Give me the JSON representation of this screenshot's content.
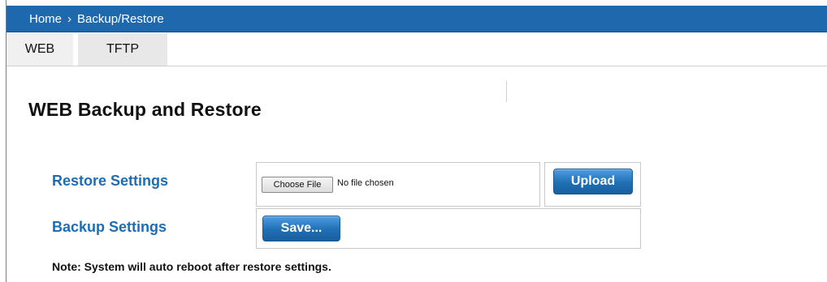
{
  "breadcrumb": {
    "home": "Home",
    "separator": "›",
    "current": "Backup/Restore"
  },
  "tabs": [
    {
      "label": "WEB"
    },
    {
      "label": "TFTP"
    }
  ],
  "page": {
    "title": "WEB Backup and Restore"
  },
  "restore": {
    "label": "Restore Settings",
    "choose_file_label": "Choose File",
    "file_status": "No file chosen",
    "upload_label": "Upload"
  },
  "backup": {
    "label": "Backup Settings",
    "save_label": "Save..."
  },
  "note": "Note: System will auto reboot after restore settings.",
  "colors": {
    "header_bar": "#1e69ae",
    "label_blue": "#1c6db4",
    "button_blue": "#1f6fb5"
  }
}
